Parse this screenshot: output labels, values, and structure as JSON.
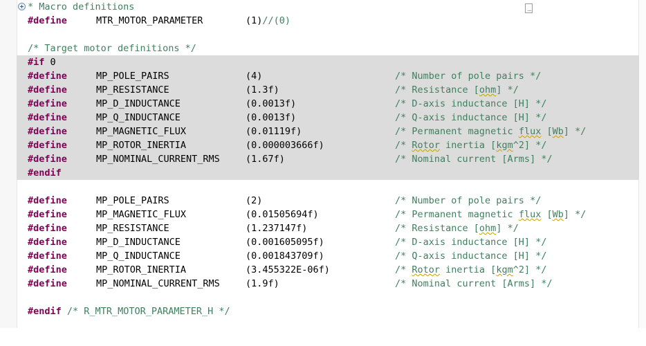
{
  "editor": {
    "macro_header": {
      "comment": "* Macro definitions",
      "define_kw": "#define",
      "name": "MTR_MOTOR_PARAMETER",
      "value": "(1)",
      "trailing_comment": "//(0)"
    },
    "target_comment": "/* Target motor definitions */",
    "if_kw": "#if",
    "if_value": "0",
    "block_a": [
      {
        "kw": "#define",
        "name": "MP_POLE_PAIRS",
        "value": "(4)",
        "cmt": [
          "/* Number of pole pairs */"
        ]
      },
      {
        "kw": "#define",
        "name": "MP_RESISTANCE",
        "value": "(1.3f)",
        "cmt": [
          "/* Resistance [",
          "ohm",
          "] */"
        ]
      },
      {
        "kw": "#define",
        "name": "MP_D_INDUCTANCE",
        "value": "(0.0013f)",
        "cmt": [
          "/* D-axis inductance [H] */"
        ]
      },
      {
        "kw": "#define",
        "name": "MP_Q_INDUCTANCE",
        "value": "(0.0013f)",
        "cmt": [
          "/* Q-axis inductance [H] */"
        ]
      },
      {
        "kw": "#define",
        "name": "MP_MAGNETIC_FLUX",
        "value": "(0.01119f)",
        "cmt": [
          "/* Permanent magnetic ",
          "flux",
          " [",
          "Wb",
          "] */"
        ]
      },
      {
        "kw": "#define",
        "name": "MP_ROTOR_INERTIA",
        "value": "(0.000003666f)",
        "cmt": [
          "/* ",
          "Rotor",
          " inertia [",
          "kgm",
          "^2] */"
        ]
      },
      {
        "kw": "#define",
        "name": "MP_NOMINAL_CURRENT_RMS",
        "value": "(1.67f)",
        "cmt": [
          "/* Nominal current [Arms] */"
        ]
      }
    ],
    "endif_kw": "#endif",
    "block_b": [
      {
        "kw": "#define",
        "name": "MP_POLE_PAIRS",
        "value": "(2)",
        "cmt": [
          "/* Number of pole pairs */"
        ]
      },
      {
        "kw": "#define",
        "name": "MP_MAGNETIC_FLUX",
        "value": "(0.01505694f)",
        "cmt": [
          "/* Permanent magnetic ",
          "flux",
          " [",
          "Wb",
          "] */"
        ]
      },
      {
        "kw": "#define",
        "name": "MP_RESISTANCE",
        "value": "(1.237147f)",
        "cmt": [
          "/* Resistance [",
          "ohm",
          "] */"
        ]
      },
      {
        "kw": "#define",
        "name": "MP_D_INDUCTANCE",
        "value": "(0.001605095f)",
        "cmt": [
          "/* D-axis inductance [H] */"
        ]
      },
      {
        "kw": "#define",
        "name": "MP_Q_INDUCTANCE",
        "value": "(0.001843709f)",
        "cmt": [
          "/* Q-axis inductance [H] */"
        ]
      },
      {
        "kw": "#define",
        "name": "MP_ROTOR_INERTIA",
        "value": "(3.455322E-06f)",
        "cmt": [
          "/* ",
          "Rotor",
          " inertia [",
          "kgm",
          "^2] */"
        ]
      },
      {
        "kw": "#define",
        "name": "MP_NOMINAL_CURRENT_RMS",
        "value": "(1.9f)",
        "cmt": [
          "/* Nominal current [Arms] */"
        ]
      }
    ],
    "final_endif": {
      "kw": "#endif",
      "comment": "/* R_MTR_MOTOR_PARAMETER_H */"
    },
    "icons": {
      "fold_expand": "plus-circle-icon",
      "fold_collapse": "minus-circle-icon",
      "overview_marker": "ellipsis-box-icon"
    },
    "colors": {
      "keyword": "#7f0055",
      "comment": "#3f7f5f",
      "inactive_block": "#dcdcdc",
      "squiggle": "#c4a000"
    }
  }
}
